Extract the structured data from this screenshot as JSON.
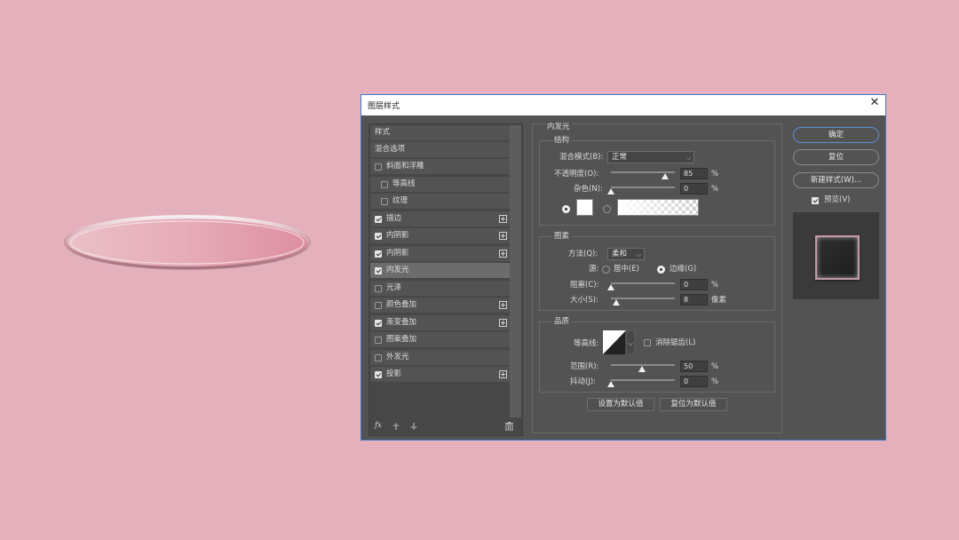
{
  "dialog": {
    "title": "图层样式",
    "close_glyph": "✕"
  },
  "style_list": {
    "header": "样式",
    "blend_options": "混合选项",
    "items": [
      {
        "label": "斜面和浮雕",
        "checked": false,
        "indent": false,
        "has_plus": false
      },
      {
        "label": "等高线",
        "checked": false,
        "indent": true,
        "has_plus": false
      },
      {
        "label": "纹理",
        "checked": false,
        "indent": true,
        "has_plus": false
      },
      {
        "label": "描边",
        "checked": true,
        "indent": false,
        "has_plus": true
      },
      {
        "label": "内阴影",
        "checked": true,
        "indent": false,
        "has_plus": true
      },
      {
        "label": "内阴影",
        "checked": true,
        "indent": false,
        "has_plus": true
      },
      {
        "label": "内发光",
        "checked": true,
        "indent": false,
        "has_plus": false,
        "selected": true
      },
      {
        "label": "光泽",
        "checked": false,
        "indent": false,
        "has_plus": false
      },
      {
        "label": "颜色叠加",
        "checked": false,
        "indent": false,
        "has_plus": true
      },
      {
        "label": "渐变叠加",
        "checked": true,
        "indent": false,
        "has_plus": true
      },
      {
        "label": "图案叠加",
        "checked": false,
        "indent": false,
        "has_plus": false
      },
      {
        "label": "外发光",
        "checked": false,
        "indent": false,
        "has_plus": false
      },
      {
        "label": "投影",
        "checked": true,
        "indent": false,
        "has_plus": true
      }
    ],
    "footer_fx": "fx",
    "footer_icons": [
      "fx-icon",
      "move-up-icon",
      "move-down-icon",
      "trash-icon"
    ]
  },
  "inner_glow": {
    "section_title": "内发光",
    "structure": {
      "title": "结构",
      "blend_mode_label": "混合模式(B):",
      "blend_mode_value": "正常",
      "opacity_label": "不透明度(O):",
      "opacity_value": "85",
      "opacity_unit": "%",
      "noise_label": "杂色(N):",
      "noise_value": "0",
      "noise_unit": "%",
      "color_swatch": "#ffffff"
    },
    "elements": {
      "title": "图素",
      "technique_label": "方法(Q):",
      "technique_value": "柔和",
      "source_label": "源:",
      "source_center": "居中(E)",
      "source_edge": "边缘(G)",
      "choke_label": "阻塞(C):",
      "choke_value": "0",
      "choke_unit": "%",
      "size_label": "大小(S):",
      "size_value": "8",
      "size_unit": "像素"
    },
    "quality": {
      "title": "品质",
      "contour_label": "等高线:",
      "antialias_label": "消除锯齿(L)",
      "range_label": "范围(R):",
      "range_value": "50",
      "range_unit": "%",
      "jitter_label": "抖动(J):",
      "jitter_value": "0",
      "jitter_unit": "%"
    },
    "make_default": "设置为默认值",
    "reset_default": "复位为默认值"
  },
  "right_panel": {
    "ok": "确定",
    "reset": "复位",
    "new_style": "新建样式(W)...",
    "preview_label": "预览(V)",
    "preview_checked": true
  },
  "colors": {
    "canvas_bg": "#e4b0bb",
    "dialog_bg": "#535353",
    "accent": "#3c78c8"
  }
}
